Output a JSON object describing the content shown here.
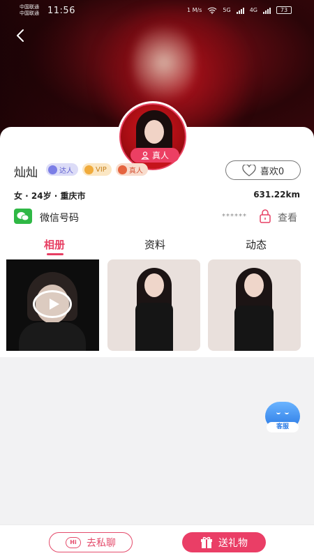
{
  "statusbar": {
    "carrier_top": "中国联通",
    "carrier_bottom": "中国联通",
    "time": "11:56",
    "net_speed": "1 M/s",
    "sig1": "5G",
    "sig2": "4G",
    "battery": "73"
  },
  "profile": {
    "name": "灿灿",
    "real_badge": "真人",
    "tags": [
      {
        "label": "达人"
      },
      {
        "label": "VIP"
      },
      {
        "label": "真人"
      }
    ],
    "like_label": "喜欢0",
    "basic_info": "女 · 24岁 · 重庆市",
    "distance": "631.22km",
    "wechat_label": "微信号码",
    "wechat_masked": "******",
    "view_label": "查看"
  },
  "tabs": [
    {
      "label": "相册",
      "active": true
    },
    {
      "label": "资料",
      "active": false
    },
    {
      "label": "动态",
      "active": false
    }
  ],
  "support": {
    "label": "客服"
  },
  "bottom": {
    "chat_icon_text": "Hi",
    "chat_label": "去私聊",
    "gift_label": "送礼物"
  },
  "colors": {
    "accent": "#e73f63",
    "wechat_green": "#2fb845"
  },
  "icons": [
    "back-arrow-icon",
    "heart-icon",
    "wechat-icon",
    "lock-icon",
    "play-icon",
    "person-badge-icon",
    "gift-icon",
    "hi-chat-icon",
    "customer-service-icon"
  ]
}
